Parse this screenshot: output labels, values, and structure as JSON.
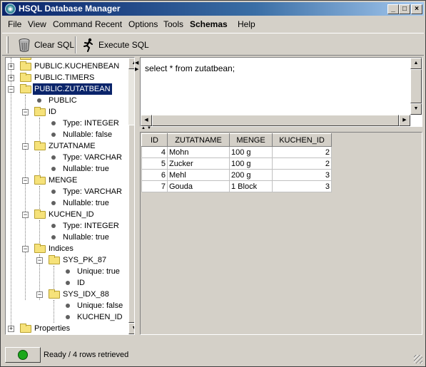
{
  "window": {
    "title": "HSQL Database Manager"
  },
  "menu": [
    "File",
    "View",
    "Command",
    "Recent",
    "Options",
    "Tools",
    "Schemas",
    "Help"
  ],
  "toolbar": {
    "clear_label": "Clear SQL",
    "execute_label": "Execute SQL"
  },
  "tree": [
    {
      "label": "PUBLIC.KUCHENBEAN",
      "kind": "folder",
      "expander": "+"
    },
    {
      "label": "PUBLIC.TIMERS",
      "kind": "folder",
      "expander": "+"
    },
    {
      "label": "PUBLIC.ZUTATBEAN",
      "kind": "folder",
      "expander": "-"
    },
    {
      "label": "PUBLIC",
      "kind": "leaf"
    },
    {
      "label": "ID",
      "kind": "folder",
      "expander": "-"
    },
    {
      "label": "Type: INTEGER",
      "kind": "leaf"
    },
    {
      "label": "Nullable: false",
      "kind": "leaf"
    },
    {
      "label": "ZUTATNAME",
      "kind": "folder",
      "expander": "-"
    },
    {
      "label": "Type: VARCHAR",
      "kind": "leaf"
    },
    {
      "label": "Nullable: true",
      "kind": "leaf"
    },
    {
      "label": "MENGE",
      "kind": "folder",
      "expander": "-"
    },
    {
      "label": "Type: VARCHAR",
      "kind": "leaf"
    },
    {
      "label": "Nullable: true",
      "kind": "leaf"
    },
    {
      "label": "KUCHEN_ID",
      "kind": "folder",
      "expander": "-"
    },
    {
      "label": "Type: INTEGER",
      "kind": "leaf"
    },
    {
      "label": "Nullable: true",
      "kind": "leaf"
    },
    {
      "label": "Indices",
      "kind": "folder",
      "expander": "-"
    },
    {
      "label": "SYS_PK_87",
      "kind": "folder",
      "expander": "-"
    },
    {
      "label": "Unique: true",
      "kind": "leaf"
    },
    {
      "label": "ID",
      "kind": "leaf"
    },
    {
      "label": "SYS_IDX_88",
      "kind": "folder",
      "expander": "-"
    },
    {
      "label": "Unique: false",
      "kind": "leaf"
    },
    {
      "label": "KUCHEN_ID",
      "kind": "leaf"
    },
    {
      "label": "Properties",
      "kind": "folder",
      "expander": "+"
    }
  ],
  "sql": {
    "text": "select * from zutatbean;"
  },
  "results": {
    "columns": [
      "ID",
      "ZUTATNAME",
      "MENGE",
      "KUCHEN_ID"
    ],
    "rows": [
      [
        "4",
        "Mohn",
        "100 g",
        "2"
      ],
      [
        "5",
        "Zucker",
        "100 g",
        "2"
      ],
      [
        "6",
        "Mehl",
        "200 g",
        "3"
      ],
      [
        "7",
        "Gouda",
        "1 Block",
        "3"
      ]
    ]
  },
  "status": {
    "text": "Ready / 4 rows retrieved"
  },
  "colors": {
    "selection": "#0a246a",
    "status_ok": "#1ba81b",
    "title_bar": "#0a246a"
  }
}
